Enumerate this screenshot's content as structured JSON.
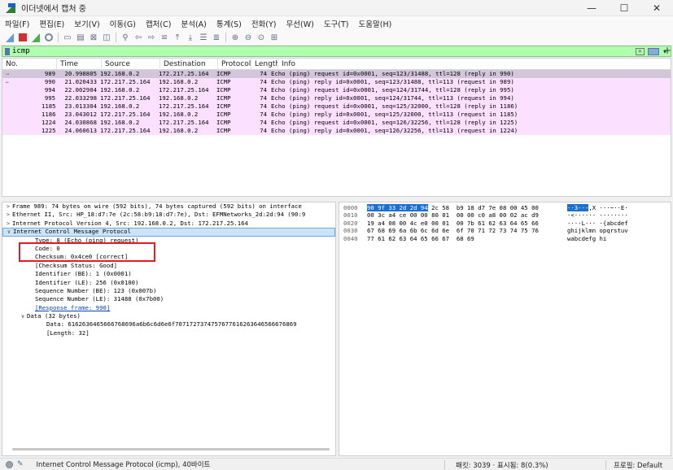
{
  "window": {
    "title": "이더넷에서 캡처 중",
    "minimize": "—",
    "maximize": "☐",
    "close": "✕"
  },
  "menu": [
    "파일(F)",
    "편집(E)",
    "보기(V)",
    "이동(G)",
    "캡처(C)",
    "분석(A)",
    "통계(S)",
    "전화(Y)",
    "무선(W)",
    "도구(T)",
    "도움말(H)"
  ],
  "filter": {
    "value": "icmp",
    "plus": "+"
  },
  "packet_list": {
    "columns": [
      "No.",
      "Time",
      "Source",
      "Destination",
      "Protocol",
      "Length",
      "Info"
    ],
    "rows": [
      {
        "arrow": "→",
        "no": "989",
        "time": "20.998805",
        "src": "192.168.0.2",
        "dst": "172.217.25.164",
        "proto": "ICMP",
        "len": "74",
        "info": "Echo (ping) request  id=0x0001, seq=123/31488, ttl=128 (reply in 990)"
      },
      {
        "arrow": "←",
        "no": "990",
        "time": "21.020433",
        "src": "172.217.25.164",
        "dst": "192.168.0.2",
        "proto": "ICMP",
        "len": "74",
        "info": "Echo (ping) reply    id=0x0001, seq=123/31488, ttl=113 (request in 989)"
      },
      {
        "arrow": "",
        "no": "994",
        "time": "22.002904",
        "src": "192.168.0.2",
        "dst": "172.217.25.164",
        "proto": "ICMP",
        "len": "74",
        "info": "Echo (ping) request  id=0x0001, seq=124/31744, ttl=128 (reply in 995)"
      },
      {
        "arrow": "",
        "no": "995",
        "time": "22.033298",
        "src": "172.217.25.164",
        "dst": "192.168.0.2",
        "proto": "ICMP",
        "len": "74",
        "info": "Echo (ping) reply    id=0x0001, seq=124/31744, ttl=113 (request in 994)"
      },
      {
        "arrow": "",
        "no": "1185",
        "time": "23.013304",
        "src": "192.168.0.2",
        "dst": "172.217.25.164",
        "proto": "ICMP",
        "len": "74",
        "info": "Echo (ping) request  id=0x0001, seq=125/32000, ttl=128 (reply in 1186)"
      },
      {
        "arrow": "",
        "no": "1186",
        "time": "23.043012",
        "src": "172.217.25.164",
        "dst": "192.168.0.2",
        "proto": "ICMP",
        "len": "74",
        "info": "Echo (ping) reply    id=0x0001, seq=125/32000, ttl=113 (request in 1185)"
      },
      {
        "arrow": "",
        "no": "1224",
        "time": "24.030868",
        "src": "192.168.0.2",
        "dst": "172.217.25.164",
        "proto": "ICMP",
        "len": "74",
        "info": "Echo (ping) request  id=0x0001, seq=126/32256, ttl=128 (reply in 1225)"
      },
      {
        "arrow": "",
        "no": "1225",
        "time": "24.060613",
        "src": "172.217.25.164",
        "dst": "192.168.0.2",
        "proto": "ICMP",
        "len": "74",
        "info": "Echo (ping) reply    id=0x0001, seq=126/32256, ttl=113 (request in 1224)"
      }
    ]
  },
  "details": [
    {
      "tog": ">",
      "indent": "ind0",
      "text": "Frame 989: 74 bytes on wire (592 bits), 74 bytes captured (592 bits) on interface"
    },
    {
      "tog": ">",
      "indent": "ind0",
      "text": "Ethernet II, Src: HP_18:d7:7e (2c:58:b9:18:d7:7e), Dst: EFMNetworks_2d:2d:94 (90:9"
    },
    {
      "tog": ">",
      "indent": "ind0",
      "text": "Internet Protocol Version 4, Src: 192.168.0.2, Dst: 172.217.25.164"
    },
    {
      "tog": "∨",
      "indent": "ind0",
      "text": "Internet Control Message Protocol",
      "sel": true
    },
    {
      "tog": "",
      "indent": "ind1",
      "text": "Type: 8 (Echo (ping) request)"
    },
    {
      "tog": "",
      "indent": "ind1",
      "text": "Code: 0"
    },
    {
      "tog": "",
      "indent": "ind1",
      "text": "Checksum: 0x4ce0 [correct]"
    },
    {
      "tog": "",
      "indent": "ind1",
      "text": "[Checksum Status: Good]"
    },
    {
      "tog": "",
      "indent": "ind1",
      "text": "Identifier (BE): 1 (0x0001)"
    },
    {
      "tog": "",
      "indent": "ind1",
      "text": "Identifier (LE): 256 (0x0100)"
    },
    {
      "tog": "",
      "indent": "ind1",
      "text": "Sequence Number (BE): 123 (0x007b)"
    },
    {
      "tog": "",
      "indent": "ind1",
      "text": "Sequence Number (LE): 31488 (0x7b00)"
    },
    {
      "tog": "",
      "indent": "ind1",
      "text": "[Response frame: 990]",
      "link": true
    },
    {
      "tog": "∨",
      "indent": "ind1b",
      "text": "Data (32 bytes)"
    },
    {
      "tog": "",
      "indent": "ind2",
      "text": "Data: 6162636465666768696a6b6c6d6e6f7071727374757677616263646566676869"
    },
    {
      "tog": "",
      "indent": "ind2",
      "text": "[Length: 32]"
    }
  ],
  "hex": [
    {
      "off": "0000",
      "hl": "90 9f 33 2d 2d 94",
      "bytes": " 2c 58  b9 18 d7 7e 08 00 45 00",
      "hl_ascii": "··3-·-",
      "ascii": ",X ···~··E·"
    },
    {
      "off": "0010",
      "hl": "",
      "bytes": "00 3c a4 ce 00 00 80 01  00 00 c0 a8 00 02 ac d9",
      "hl_ascii": "",
      "ascii": "·<······ ········"
    },
    {
      "off": "0020",
      "hl": "",
      "bytes": "19 a4 08 00 4c e0 00 01  00 7b 61 62 63 64 65 66",
      "hl_ascii": "",
      "ascii": "····L··· ·{abcdef"
    },
    {
      "off": "0030",
      "hl": "",
      "bytes": "67 68 69 6a 6b 6c 6d 6e  6f 70 71 72 73 74 75 76",
      "hl_ascii": "",
      "ascii": "ghijklmn opqrstuv"
    },
    {
      "off": "0040",
      "hl": "",
      "bytes": "77 61 62 63 64 65 66 67  68 69",
      "hl_ascii": "",
      "ascii": "wabcdefg hi"
    }
  ],
  "status": {
    "text": "Internet Control Message Protocol (icmp), 40바이트",
    "count": "패킷: 3039 · 표시됨: 8(0.3%)",
    "profile": "프로필: Default"
  }
}
